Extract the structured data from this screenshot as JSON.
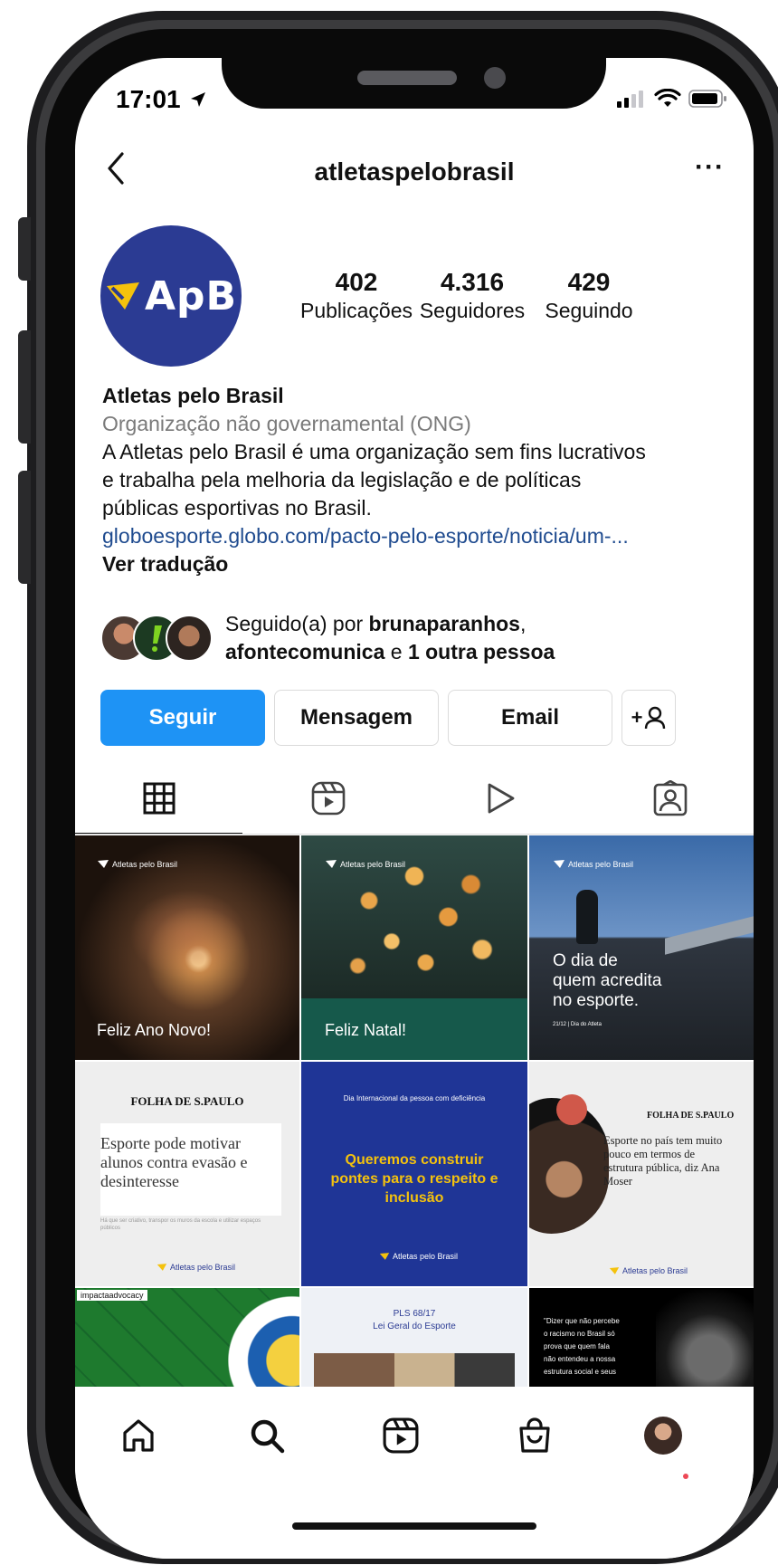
{
  "status_bar": {
    "time": "17:01"
  },
  "header": {
    "username": "atletaspelobrasil",
    "more_label": "···"
  },
  "profile": {
    "logo_text": "ApB",
    "stats": [
      {
        "value": "402",
        "label": "Publicações"
      },
      {
        "value": "4.316",
        "label": "Seguidores"
      },
      {
        "value": "429",
        "label": "Seguindo"
      }
    ],
    "name": "Atletas pelo Brasil",
    "category": "Organização não governamental (ONG)",
    "bio_line1": "A Atletas pelo Brasil é uma organização sem fins lucrativos",
    "bio_line2": "e trabalha pela melhoria da legislação e de políticas",
    "bio_line3": "públicas esportivas no Brasil.",
    "link": "globoesporte.globo.com/pacto-pelo-esporte/noticia/um-...",
    "translate": "Ver tradução"
  },
  "followed_by": {
    "prefix": "Seguido(a) por ",
    "user1": "brunaparanhos",
    "comma": ",",
    "user2": "afontecomunica",
    "middle": " e ",
    "others": "1 outra pessoa"
  },
  "actions": {
    "follow": "Seguir",
    "message": "Mensagem",
    "email": "Email",
    "add_person": "+"
  },
  "posts": {
    "brand": "Atletas pelo Brasil",
    "p1_caption": "Feliz Ano Novo!",
    "p2_caption": "Feliz Natal!",
    "p3_caption_line1": "O dia de",
    "p3_caption_line2": "quem acredita",
    "p3_caption_line3": "no esporte.",
    "p3_footer": "21/12 | Dia do Atleta",
    "p4_masthead": "FOLHA DE S.PAULO",
    "p4_headline_line1": "Esporte pode motivar",
    "p4_headline_line2": "alunos contra evasão e",
    "p4_headline_line3": "desinteresse",
    "p4_sub": "Há que ser criativo, transpor os muros da escola e utilizar espaços públicos",
    "p5_top": "Dia Internacional da pessoa com deficiência",
    "p5_line1": "Queremos construir",
    "p5_line2": "pontes para o respeito e",
    "p5_line3": "inclusão",
    "p6_masthead": "FOLHA DE S.PAULO",
    "p6_headline_line1": "Esporte no país tem muito",
    "p6_headline_line2": "pouco em termos de",
    "p6_headline_line3": "estrutura pública, diz Ana",
    "p6_headline_line4": "Moser",
    "p7_tag": "impactaadvocacy",
    "p8_line1": "PLS 68/17",
    "p8_line2": "Lei Geral do Esporte",
    "p9_line1": "\"Dizer que não percebe",
    "p9_line2": "o racismo no Brasil só",
    "p9_line3": "prova que quem fala",
    "p9_line4": "não entendeu a nossa",
    "p9_line5": "estrutura social e seus"
  },
  "colors": {
    "primary_button": "#1e93f5",
    "avatar_bg": "#2b3b93",
    "logo_yellow": "#f4c20d",
    "link": "#1f4b8f"
  }
}
